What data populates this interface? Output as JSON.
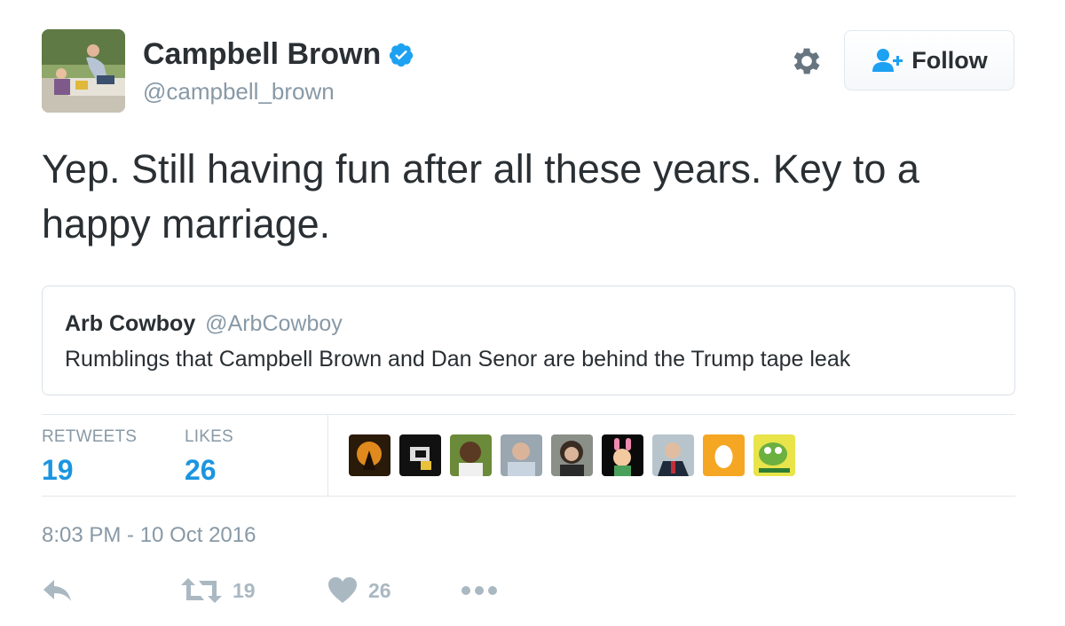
{
  "author": {
    "name": "Campbell Brown",
    "handle": "@campbell_brown",
    "verified_icon": "verified-badge-icon"
  },
  "header": {
    "settings_icon": "gear-icon",
    "follow_label": "Follow",
    "follow_icon": "add-user-icon"
  },
  "tweet": {
    "text": "Yep. Still having fun after all these years. Key to a happy marriage."
  },
  "quoted_tweet": {
    "name": "Arb Cowboy",
    "handle": "@ArbCowboy",
    "text": "Rumblings that Campbell Brown and Dan Senor are behind the Trump tape leak"
  },
  "stats": {
    "retweets_label": "RETWEETS",
    "retweets_count": "19",
    "likes_label": "LIKES",
    "likes_count": "26"
  },
  "timestamp": "8:03 PM - 10 Oct 2016",
  "actions": {
    "reply_icon": "reply-icon",
    "retweet_icon": "retweet-icon",
    "retweet_count": "19",
    "like_icon": "heart-icon",
    "like_count": "26",
    "more_icon": "more-dots-icon"
  },
  "colors": {
    "accent": "#1b95e0",
    "verified": "#1da1f2",
    "muted": "#8899a6",
    "text": "#292f33"
  }
}
